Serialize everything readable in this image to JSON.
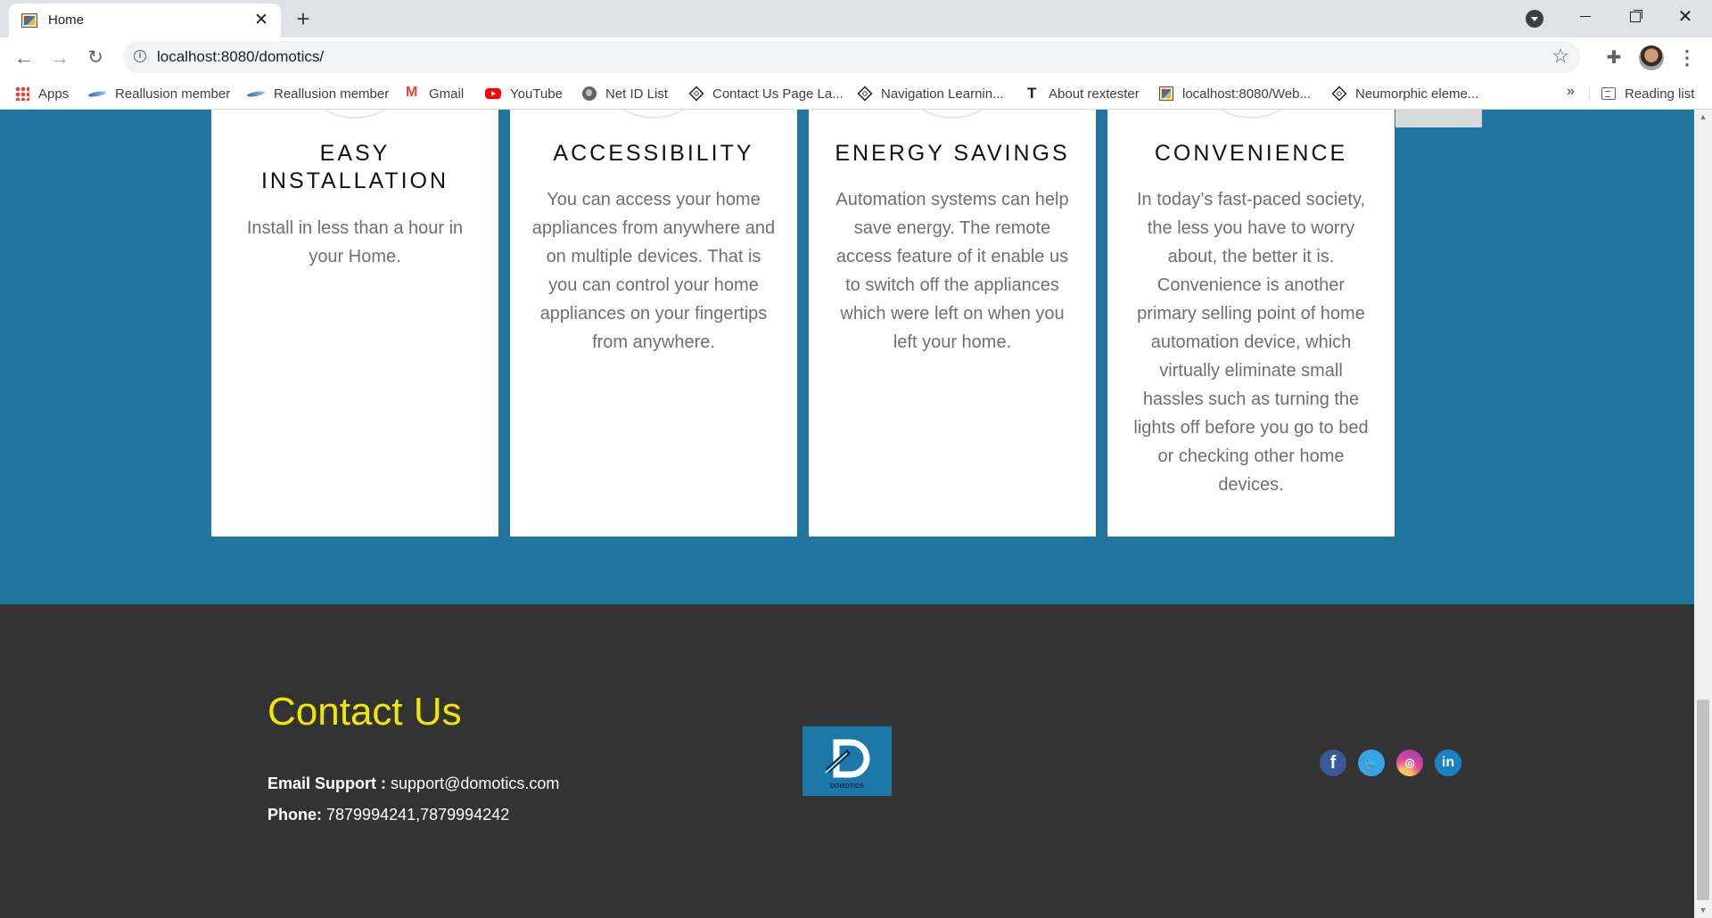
{
  "browser": {
    "tab": {
      "title": "Home",
      "close": "✕"
    },
    "new_tab": "+",
    "window_controls": {
      "minimize": "minimize",
      "maximize": "maximize",
      "close": "✕"
    },
    "url": "localhost:8080/domotics/",
    "bookmarks": [
      {
        "label": "Apps",
        "icon": "apps-grid-icon"
      },
      {
        "label": "Reallusion member",
        "icon": "reallusion-icon"
      },
      {
        "label": "Reallusion member",
        "icon": "reallusion-icon"
      },
      {
        "label": "Gmail",
        "icon": "gmail-icon"
      },
      {
        "label": "YouTube",
        "icon": "youtube-icon"
      },
      {
        "label": "Net ID List",
        "icon": "globe-icon"
      },
      {
        "label": "Contact Us Page La...",
        "icon": "codepen-icon"
      },
      {
        "label": "Navigation Learnin...",
        "icon": "codepen-icon"
      },
      {
        "label": "About rextester",
        "icon": "t-icon"
      },
      {
        "label": "localhost:8080/Web...",
        "icon": "localhost-icon"
      },
      {
        "label": "Neumorphic eleme...",
        "icon": "codepen-icon"
      }
    ],
    "bookmarks_more": "»",
    "reading_list": "Reading list"
  },
  "features": [
    {
      "title": "EASY INSTALLATION",
      "body": "Install in less than a hour in your Home."
    },
    {
      "title": "ACCESSIBILITY",
      "body": "You can access your home appliances from anywhere and on multiple devices. That is you can control your home appliances on your fingertips from anywhere."
    },
    {
      "title": "ENERGY SAVINGS",
      "body": "Automation systems can help save energy. The remote access feature of it enable us to switch off the appliances which were left on when you left your home."
    },
    {
      "title": "CONVENIENCE",
      "body": "In today’s fast-paced society, the less you have to worry about, the better it is. Convenience is another primary selling point of home automation device, which virtually eliminate small hassles such as turning the lights off before you go to bed or checking other home devices."
    }
  ],
  "footer": {
    "contact_title": "Contact Us",
    "email_label": "Email Support :",
    "email_value": "support@domotics.com",
    "phone_label": "Phone:",
    "phone_value": "7879994241,7879994242",
    "logo_text": "DOMOTICS",
    "social": [
      {
        "name": "facebook",
        "glyph": "f"
      },
      {
        "name": "twitter",
        "glyph": "🐦"
      },
      {
        "name": "instagram",
        "glyph": "◎"
      },
      {
        "name": "linkedin",
        "glyph": "in"
      }
    ]
  },
  "colors": {
    "section_blue": "#21759f",
    "footer_bg": "#333333",
    "contact_title": "#f2e600"
  }
}
